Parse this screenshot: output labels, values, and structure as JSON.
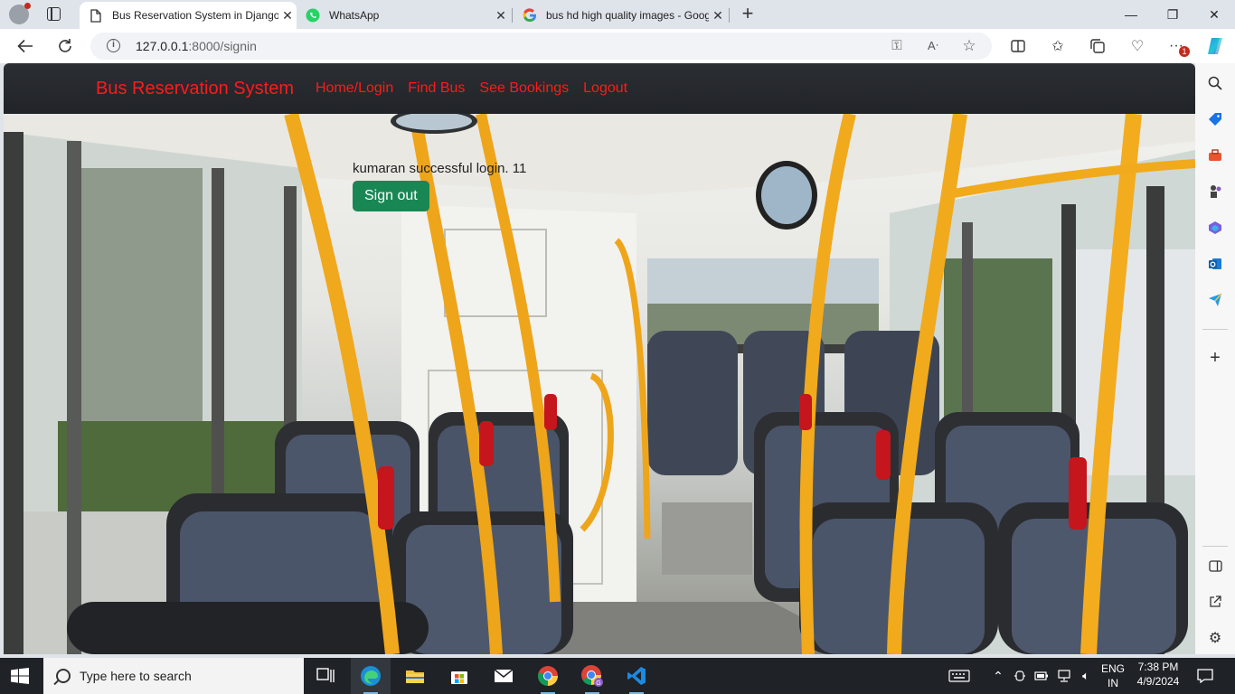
{
  "browser": {
    "tabs": [
      {
        "title": "Bus Reservation System in Django",
        "favicon": "page-icon",
        "active": true
      },
      {
        "title": "WhatsApp",
        "favicon": "whatsapp-icon",
        "active": false
      },
      {
        "title": "bus hd high quality images - Google",
        "favicon": "google-icon",
        "active": false
      }
    ],
    "address": {
      "host": "127.0.0.1",
      "rest": ":8000/signin"
    },
    "notification_badge": "1"
  },
  "site": {
    "brand": "Bus Reservation System",
    "nav": [
      "Home/Login",
      "Find Bus",
      "See Bookings",
      "Logout"
    ],
    "message": "kumaran successful login. 11",
    "signout_label": "Sign out",
    "colors": {
      "brand": "#ff1a1a",
      "navbar": "#212428",
      "signout_button": "#198754"
    }
  },
  "taskbar": {
    "search_placeholder": "Type here to search",
    "language": "ENG",
    "region": "IN",
    "time": "7:38 PM",
    "date": "4/9/2024"
  }
}
